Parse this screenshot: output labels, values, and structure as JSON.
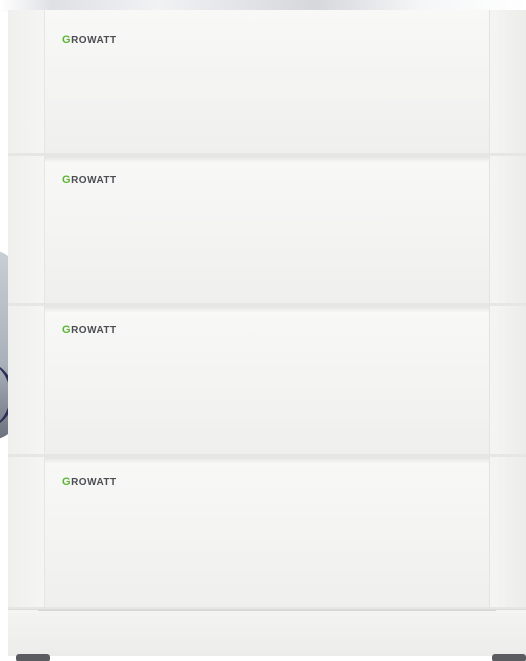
{
  "product": {
    "brand_first_letter": "G",
    "brand_rest": "ROWATT",
    "module_count": 4,
    "modules": [
      {
        "brand_first_letter": "G",
        "brand_rest": "ROWATT"
      },
      {
        "brand_first_letter": "G",
        "brand_rest": "ROWATT"
      },
      {
        "brand_first_letter": "G",
        "brand_rest": "ROWATT"
      },
      {
        "brand_first_letter": "G",
        "brand_rest": "ROWATT"
      }
    ]
  },
  "colors": {
    "brand_green": "#5cb531",
    "brand_gray": "#4b4d52",
    "casing": "#f3f3f2"
  },
  "icons": [
    "growatt-logo"
  ]
}
